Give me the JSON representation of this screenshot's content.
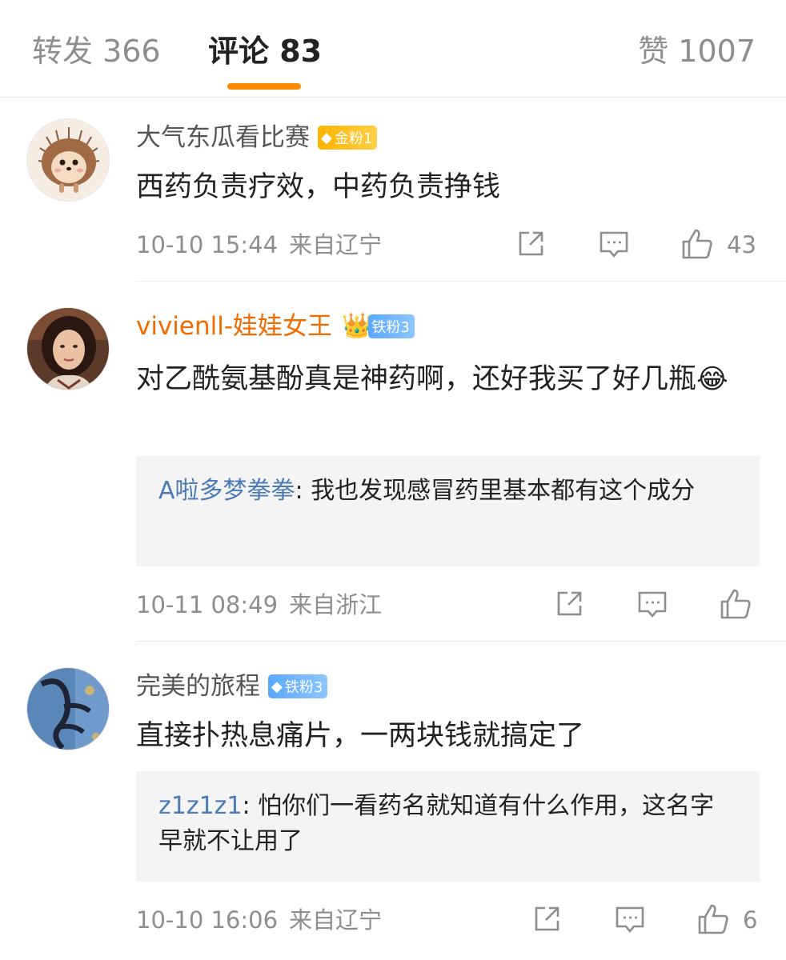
{
  "tabs": {
    "reposts": "转发 366",
    "comments": "评论 83",
    "likes": "赞 1007"
  },
  "colors": {
    "accent": "#ff8a00",
    "username_highlight": "#f26b00",
    "reply_user": "#4a7ab8",
    "badge_gold": "#ffb300",
    "badge_blue": "#5aa8ff"
  },
  "comments": [
    {
      "username": "大气东瓜看比赛",
      "badge": "金粉1",
      "avatar": "hedgehog-avatar",
      "text": "西药负责疗效，中药负责挣钱",
      "time": "10-10 15:44",
      "location": "来自辽宁",
      "likes": "43"
    },
    {
      "username": "vivienll-娃娃女王",
      "badge": "铁粉3",
      "avatar": "portrait-avatar",
      "text": "对乙酰氨基酚真是神药啊，还好我买了好几瓶",
      "emoji": "😂",
      "reply_user": "A啦多梦拳拳",
      "reply_text": "我也发现感冒药里基本都有这个成分",
      "time": "10-11 08:49",
      "location": "来自浙江",
      "likes": ""
    },
    {
      "username": "完美的旅程",
      "badge": "铁粉3",
      "avatar": "blue-pattern-avatar",
      "text": "直接扑热息痛片，一两块钱就搞定了",
      "reply_user": "z1z1z1",
      "reply_text": "怕你们一看药名就知道有什么作用，这名字早就不让用了",
      "time": "10-10 16:06",
      "location": "来自辽宁",
      "likes": "6"
    }
  ]
}
